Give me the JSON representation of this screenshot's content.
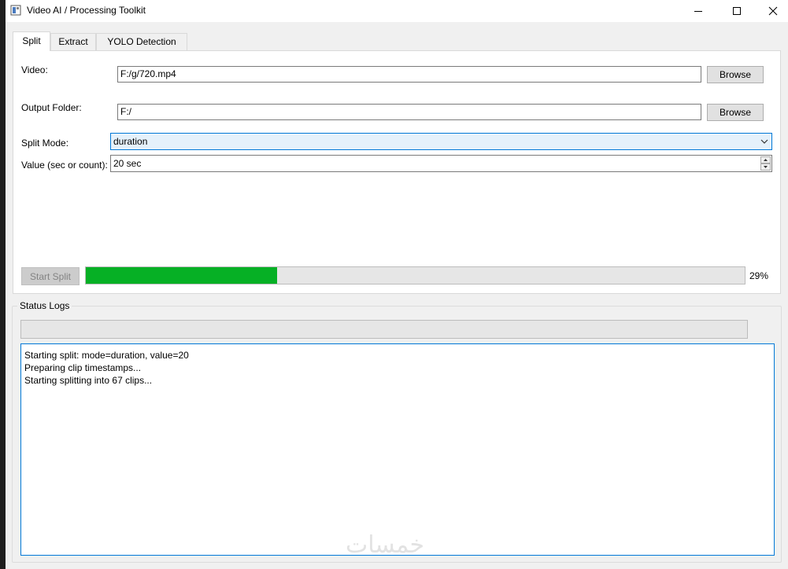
{
  "window": {
    "title": "Video AI / Processing Toolkit"
  },
  "tabs": [
    {
      "label": "Split",
      "active": true
    },
    {
      "label": "Extract",
      "active": false
    },
    {
      "label": "YOLO Detection",
      "active": false
    }
  ],
  "split": {
    "video_label": "Video:",
    "video_value": "F:/g/720.mp4",
    "video_browse": "Browse",
    "output_label": "Output Folder:",
    "output_value": "F:/",
    "output_browse": "Browse",
    "mode_label": "Split Mode:",
    "mode_value": "duration",
    "value_label": "Value (sec or count):",
    "value_value": "20 sec",
    "start_button": "Start Split",
    "progress_percent": 29,
    "progress_text": "29%"
  },
  "status": {
    "group_title": "Status  Logs",
    "status_text": "",
    "logs": [
      "Starting split: mode=duration, value=20",
      "Preparing clip timestamps...",
      "Starting splitting into 67 clips..."
    ]
  },
  "watermark": "خمسات",
  "colors": {
    "progress_fill": "#06b025",
    "focus_border": "#0078d7",
    "combo_bg": "#e5f1fb"
  }
}
